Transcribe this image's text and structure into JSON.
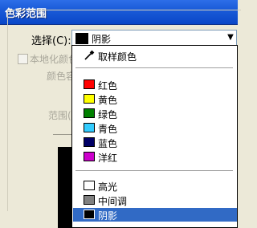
{
  "window": {
    "title": "色彩范围"
  },
  "select_label": "选择(C):",
  "combo": {
    "value": "阴影",
    "swatch_color": "#000000"
  },
  "background": {
    "checkbox_label": "本地化颜色",
    "fuzziness_label": "颜色容",
    "range_label": "范围("
  },
  "dropdown": {
    "sample": {
      "label": "取样颜色",
      "icon": "eyedropper-icon"
    },
    "colors": [
      {
        "label": "红色",
        "color": "#ff0000"
      },
      {
        "label": "黄色",
        "color": "#ffff00"
      },
      {
        "label": "绿色",
        "color": "#008000"
      },
      {
        "label": "青色",
        "color": "#33ccff"
      },
      {
        "label": "蓝色",
        "color": "#000066"
      },
      {
        "label": "洋红",
        "color": "#cc00cc"
      }
    ],
    "tones": [
      {
        "label": "高光",
        "color": "#ffffff"
      },
      {
        "label": "中间调",
        "color": "#808080"
      },
      {
        "label": "阴影",
        "color": "#000000",
        "selected": true
      }
    ]
  }
}
